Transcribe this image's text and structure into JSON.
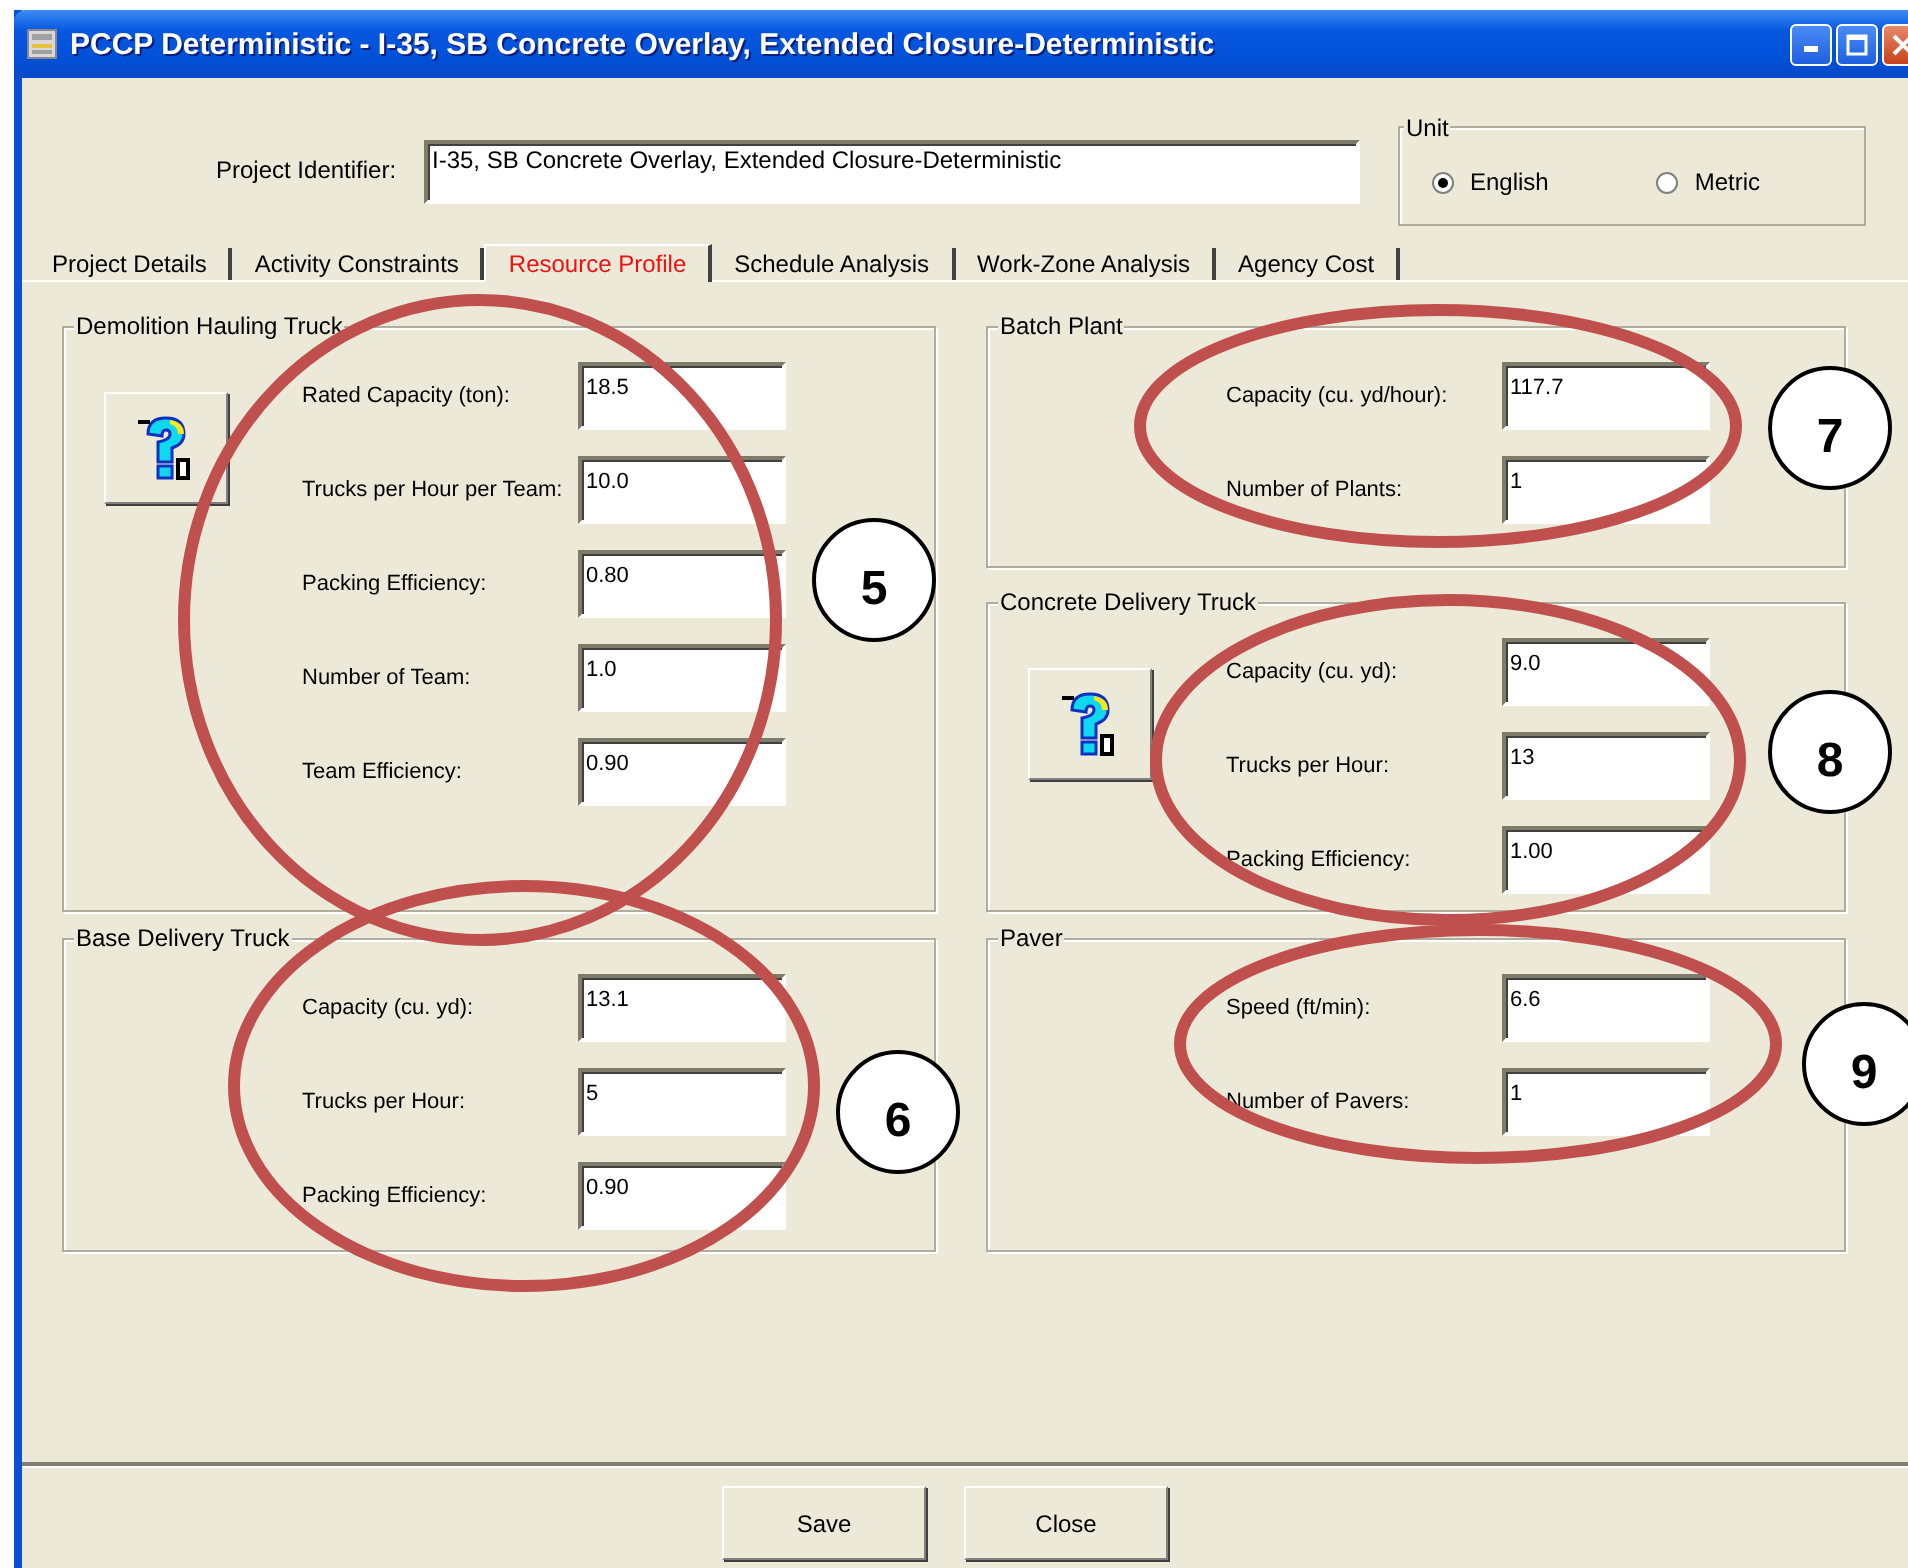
{
  "window": {
    "title": "PCCP Deterministic - I-35, SB Concrete Overlay, Extended Closure-Deterministic"
  },
  "project_identifier": {
    "label": "Project Identifier:",
    "value": "I-35, SB Concrete Overlay, Extended Closure-Deterministic"
  },
  "unit": {
    "title": "Unit",
    "options": [
      {
        "label": "English",
        "selected": true
      },
      {
        "label": "Metric",
        "selected": false
      }
    ]
  },
  "tabs": [
    {
      "label": "Project Details",
      "selected": false
    },
    {
      "label": "Activity Constraints",
      "selected": false
    },
    {
      "label": "Resource Profile",
      "selected": true
    },
    {
      "label": "Schedule Analysis",
      "selected": false
    },
    {
      "label": "Work-Zone Analysis",
      "selected": false
    },
    {
      "label": "Agency Cost",
      "selected": false
    }
  ],
  "left_column": [
    {
      "title": "Demolition Hauling Truck",
      "info_button": true,
      "fields": [
        {
          "label": "Rated Capacity (ton):",
          "value": "18.5"
        },
        {
          "label": "Trucks per Hour per Team:",
          "value": "10.0"
        },
        {
          "label": "Packing Efficiency:",
          "value": "0.80"
        },
        {
          "label": "Number of Team:",
          "value": "1.0"
        },
        {
          "label": "Team Efficiency:",
          "value": "0.90"
        }
      ]
    },
    {
      "title": "Base Delivery Truck",
      "info_button": false,
      "fields": [
        {
          "label": "Capacity (cu. yd):",
          "value": "13.1"
        },
        {
          "label": "Trucks per Hour:",
          "value": "5"
        },
        {
          "label": "Packing Efficiency:",
          "value": "0.90"
        }
      ]
    }
  ],
  "right_column": [
    {
      "title": "Batch Plant",
      "info_button": false,
      "fields": [
        {
          "label": "Capacity (cu. yd/hour):",
          "value": "117.7"
        },
        {
          "label": "Number of Plants:",
          "value": "1"
        }
      ]
    },
    {
      "title": "Concrete Delivery Truck",
      "info_button": true,
      "fields": [
        {
          "label": "Capacity (cu. yd):",
          "value": "9.0"
        },
        {
          "label": "Trucks per Hour:",
          "value": "13"
        },
        {
          "label": "Packing Efficiency:",
          "value": "1.00"
        }
      ]
    },
    {
      "title": "Paver",
      "info_button": false,
      "fields": [
        {
          "label": "Speed (ft/min):",
          "value": "6.6"
        },
        {
          "label": "Number of Pavers:",
          "value": "1"
        }
      ]
    }
  ],
  "annotations": [
    {
      "number": "5"
    },
    {
      "number": "6"
    },
    {
      "number": "7"
    },
    {
      "number": "8"
    },
    {
      "number": "9"
    }
  ],
  "buttons": [
    "Save",
    "Close"
  ]
}
